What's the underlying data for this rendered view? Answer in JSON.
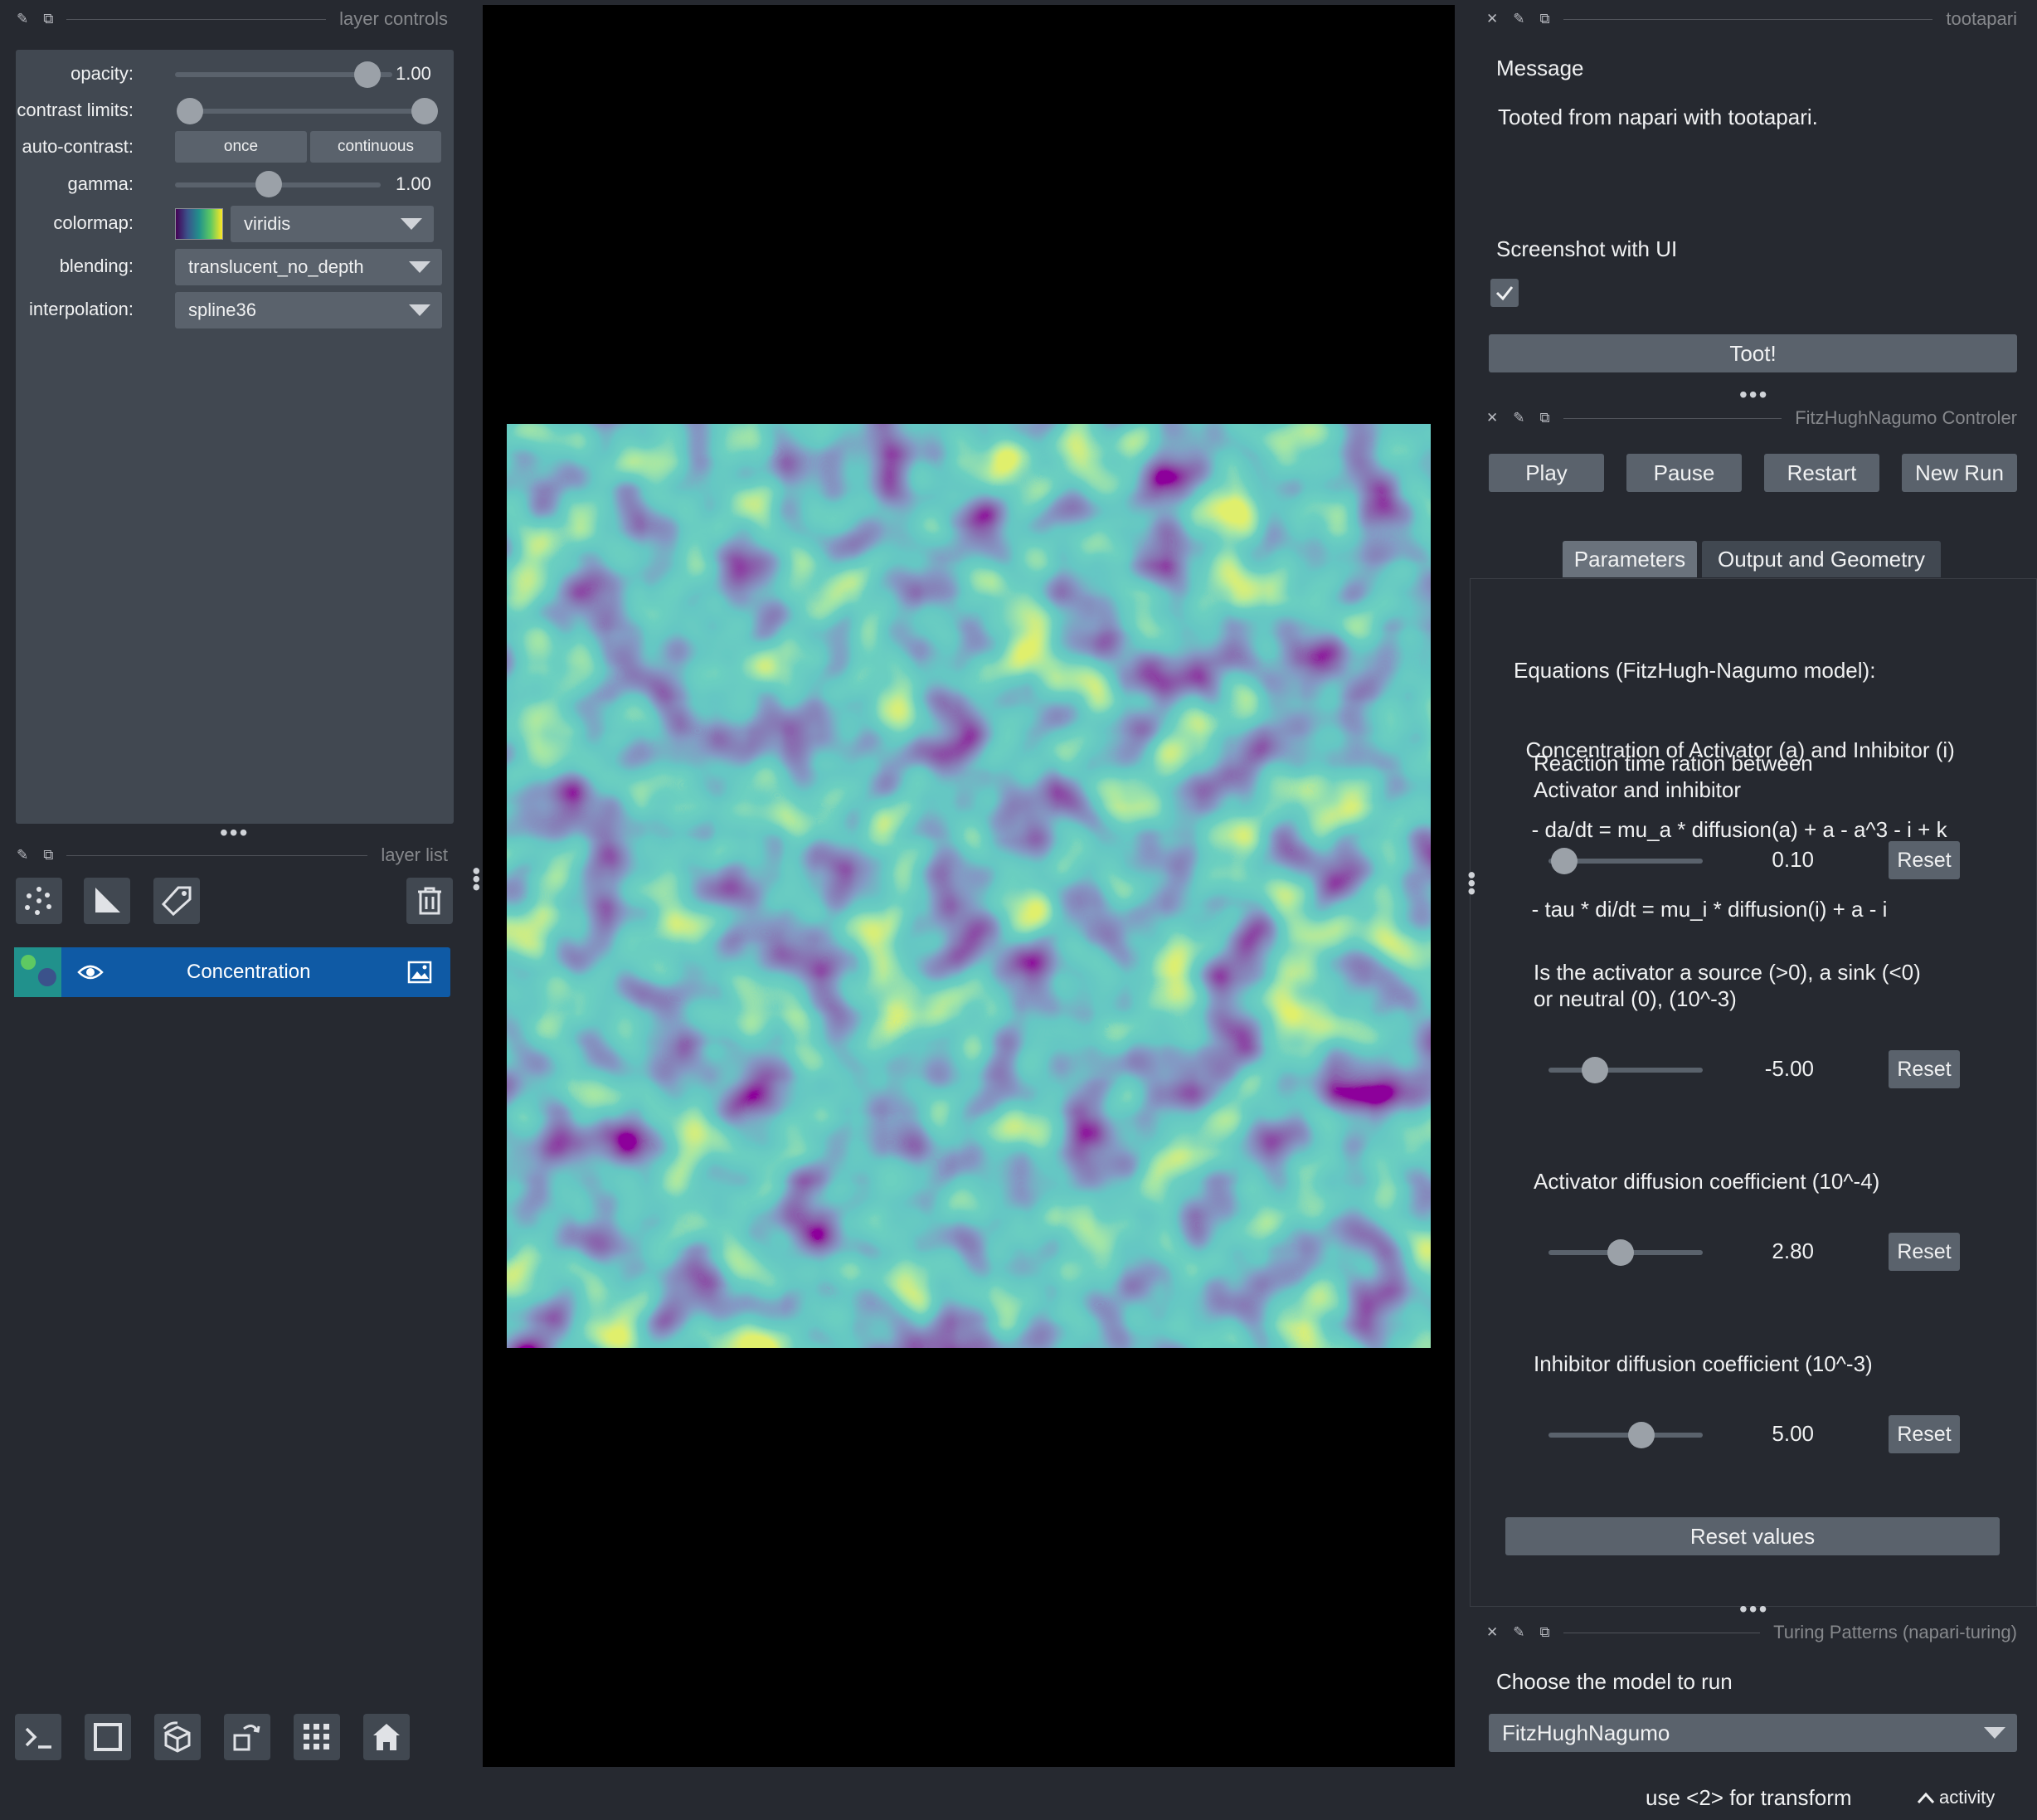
{
  "layer_controls": {
    "title": "layer controls",
    "opacity_label": "opacity:",
    "opacity_value": "1.00",
    "opacity_level": 1.0,
    "contrast_label": "contrast limits:",
    "autocontrast_label": "auto-contrast:",
    "once_label": "once",
    "continuous_label": "continuous",
    "gamma_label": "gamma:",
    "gamma_value": "1.00",
    "colormap_label": "colormap:",
    "colormap_value": "viridis",
    "blending_label": "blending:",
    "blending_value": "translucent_no_depth",
    "interpolation_label": "interpolation:",
    "interpolation_value": "spline36"
  },
  "layer_list": {
    "title": "layer list",
    "layers": [
      {
        "name": "Concentration",
        "visible": true
      }
    ]
  },
  "tootapari": {
    "title": "tootapari",
    "message_label": "Message",
    "message_text": "Tooted from napari with tootapari.",
    "screenshot_label": "Screenshot with UI",
    "screenshot_checked": true,
    "toot_button": "Toot!"
  },
  "controler": {
    "title": "FitzHughNagumo Controler",
    "buttons": [
      "Play",
      "Pause",
      "Restart",
      "New Run"
    ],
    "tabs": [
      "Parameters",
      "Output and Geometry"
    ],
    "active_tab": "Parameters",
    "equations": [
      "Equations (FitzHugh-Nagumo model):",
      "  Concentration of Activator (a) and Inhibitor (i)",
      "   - da/dt = mu_a * diffusion(a) + a - a^3 - i + k",
      "   - tau * di/dt = mu_i * diffusion(i) + a - i"
    ],
    "params": [
      {
        "label": [
          "Reaction time ration between",
          "Activator and inhibitor"
        ],
        "value": "0.10",
        "level": 0.1,
        "reset": "Reset"
      },
      {
        "label": [
          "Is the activator a source (>0), a sink (<0)",
          "or neutral (0), (10^-3)"
        ],
        "value": "-5.00",
        "level": 0.3,
        "reset": "Reset"
      },
      {
        "label": [
          "Activator diffusion coefficient (10^-4)"
        ],
        "value": "2.80",
        "level": 0.47,
        "reset": "Reset"
      },
      {
        "label": [
          "Inhibitor diffusion coefficient (10^-3)"
        ],
        "value": "5.00",
        "level": 0.6,
        "reset": "Reset"
      }
    ],
    "reset_values": "Reset values"
  },
  "turing": {
    "title": "Turing Patterns (napari-turing)",
    "choose_label": "Choose the model to run",
    "model_value": "FitzHughNagumo"
  },
  "status": {
    "hint": "use <2> for transform",
    "activity": "activity"
  },
  "colors": {
    "background": "#262930",
    "panel": "#414851",
    "button": "#5a626c",
    "selected_layer": "#0f5aa5"
  }
}
